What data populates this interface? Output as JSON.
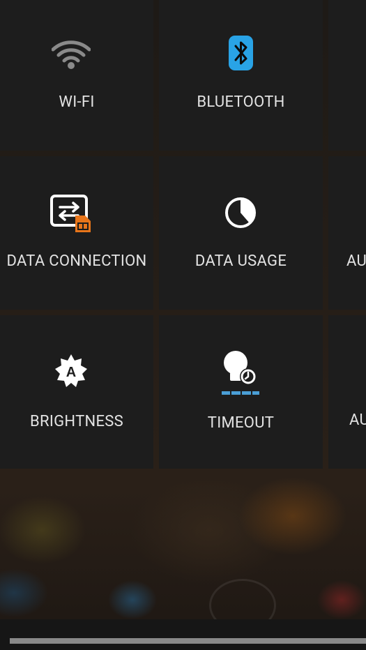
{
  "tiles": [
    {
      "label": "WI-FI",
      "icon": "wifi-icon"
    },
    {
      "label": "BLUETOOTH",
      "icon": "bluetooth-icon"
    },
    {
      "label": "DATA CONNECTION",
      "icon": "data-connection-icon"
    },
    {
      "label": "DATA USAGE",
      "icon": "data-usage-icon"
    },
    {
      "label": "AU",
      "icon": ""
    },
    {
      "label": "BRIGHTNESS",
      "icon": "brightness-auto-icon"
    },
    {
      "label": "TIMEOUT",
      "icon": "timeout-icon"
    },
    {
      "label": "AU",
      "icon": ""
    }
  ],
  "colors": {
    "bluetooth": "#29a3e6",
    "sim_orange": "#e8751a",
    "timeout_bar": "#4a9fd6",
    "label": "#e3e3e3",
    "tile": "#1d1d1d"
  }
}
